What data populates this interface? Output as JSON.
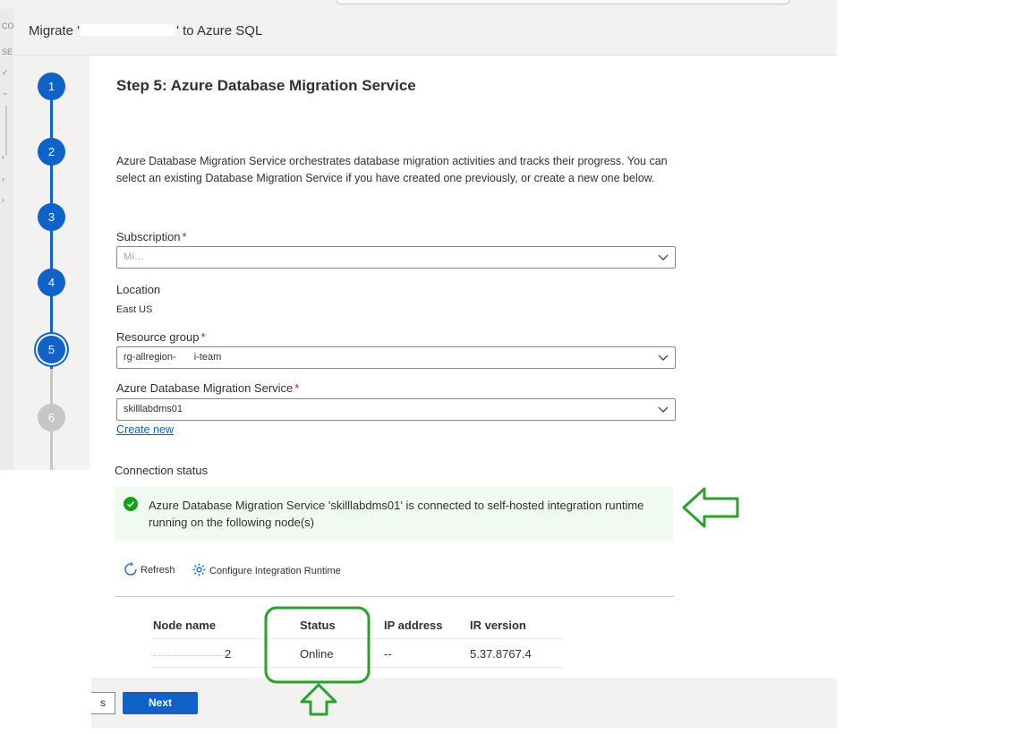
{
  "window": {
    "title_prefix": "Migrate '",
    "title_suffix": "' to Azure SQL"
  },
  "background_left": {
    "items": [
      "CO",
      "SE"
    ]
  },
  "stepper": {
    "steps": [
      "1",
      "2",
      "3",
      "4",
      "5",
      "6"
    ],
    "current_step": 5
  },
  "page": {
    "title": "Step 5: Azure Database Migration Service",
    "description": "Azure Database Migration Service orchestrates database migration activities and tracks their progress. You can select an existing Database Migration Service if you have created one previously, or create a new one below."
  },
  "form": {
    "subscription_label": "Subscription",
    "subscription_value": "Mi...",
    "location_label": "Location",
    "location_value": "East US",
    "resource_group_label": "Resource group",
    "resource_group_value_start": "rg-allregion-",
    "resource_group_value_end": "i-team",
    "dms_label": "Azure Database Migration Service",
    "dms_value": "skilllabdms01",
    "create_new_link": "Create new",
    "required_mark": "*"
  },
  "connection": {
    "label": "Connection status",
    "message": "Azure Database Migration Service 'skilllabdms01' is connected to self-hosted integration runtime running on the following node(s)"
  },
  "toolbar": {
    "refresh_label": "Refresh",
    "configure_label": "Configure Integration Runtime"
  },
  "nodes_table": {
    "columns": [
      "Node name",
      "Status",
      "IP address",
      "IR version"
    ],
    "rows": [
      {
        "node_name": "2",
        "status": "Online",
        "ip_address": "--",
        "ir_version": "5.37.8767.4"
      }
    ]
  },
  "footer": {
    "previous_label": "s",
    "next_label": "Next"
  },
  "colors": {
    "accent": "#0f62c8",
    "success": "#13a10e",
    "annotation": "#2ca02c",
    "banner_bg": "#f1faf1"
  }
}
